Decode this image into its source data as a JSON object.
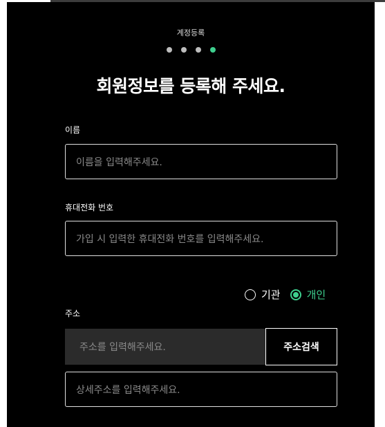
{
  "step_label": "계정등록",
  "progress": {
    "total_steps": 4,
    "current_step": 4
  },
  "colors": {
    "accent": "#3ecf8e",
    "background": "#000000",
    "input_bg": "#2b2b2b"
  },
  "title": "회원정보를 등록해 주세요.",
  "name_field": {
    "label": "이름",
    "placeholder": "이름을 입력해주세요."
  },
  "phone_field": {
    "label": "휴대전화 번호",
    "placeholder": "가입 시 입력한 휴대전화 번호를 입력해주세요."
  },
  "type_options": [
    {
      "label": "기관",
      "selected": false
    },
    {
      "label": "개인",
      "selected": true
    }
  ],
  "address_field": {
    "label": "주소",
    "placeholder": "주소를 입력해주세요.",
    "search_button": "주소검색",
    "detail_placeholder": "상세주소를 입력해주세요."
  }
}
